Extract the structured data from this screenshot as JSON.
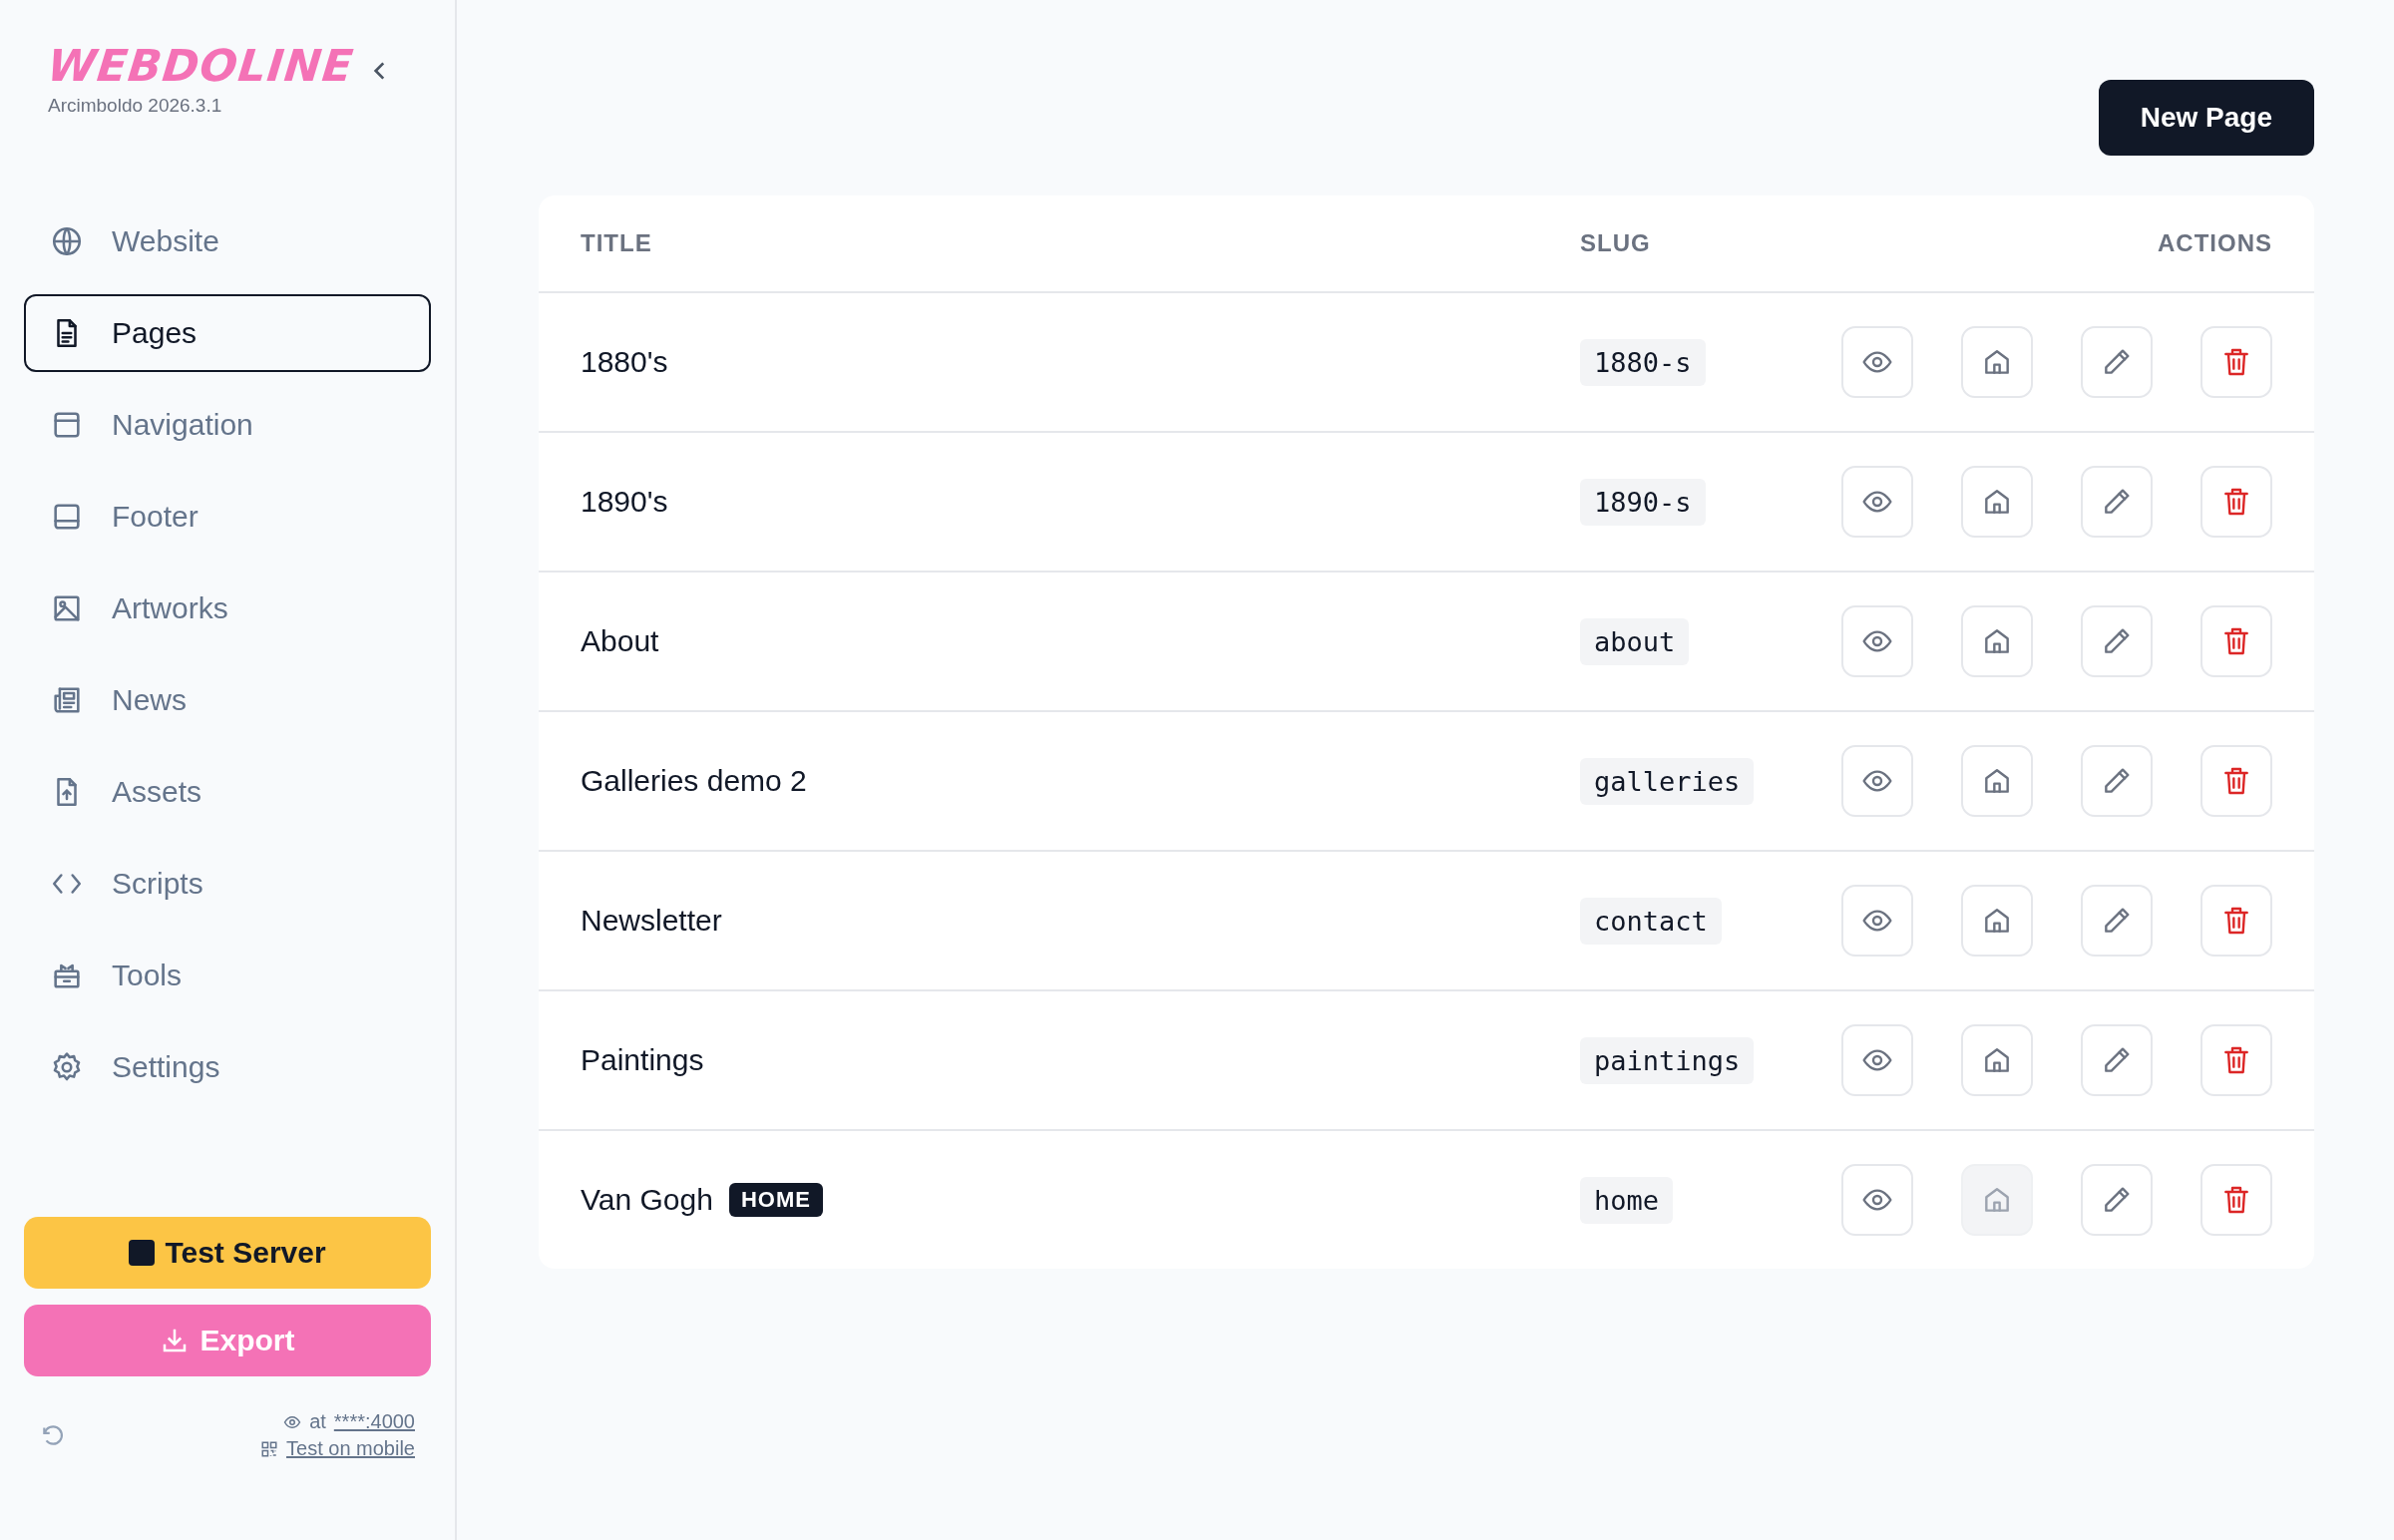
{
  "sidebar": {
    "logo": "WEBDOLINE",
    "version": "Arcimboldo 2026.3.1",
    "items": [
      {
        "label": "Website",
        "selected": false
      },
      {
        "label": "Pages",
        "selected": true
      },
      {
        "label": "Navigation",
        "selected": false
      },
      {
        "label": "Footer",
        "selected": false
      },
      {
        "label": "Artworks",
        "selected": false
      },
      {
        "label": "News",
        "selected": false
      },
      {
        "label": "Assets",
        "selected": false
      },
      {
        "label": "Scripts",
        "selected": false
      },
      {
        "label": "Tools",
        "selected": false
      },
      {
        "label": "Settings",
        "selected": false
      }
    ],
    "test_server": "Test Server",
    "export": "Export",
    "server_at": "at",
    "server_address": "****:4000",
    "mobile_link": "Test on mobile"
  },
  "new_page": "New Page",
  "table": {
    "columns": [
      "TITLE",
      "SLUG",
      "ACTIONS"
    ],
    "rows": [
      {
        "title": "1880's",
        "slug": "1880-s",
        "is_home": false
      },
      {
        "title": "1890's",
        "slug": "1890-s",
        "is_home": false
      },
      {
        "title": "About",
        "slug": "about",
        "is_home": false
      },
      {
        "title": "Galleries demo 2",
        "slug": "galleries",
        "is_home": false
      },
      {
        "title": "Newsletter",
        "slug": "contact",
        "is_home": false
      },
      {
        "title": "Paintings",
        "slug": "paintings",
        "is_home": false
      },
      {
        "title": "Van Gogh",
        "badge": "HOME",
        "slug": "home",
        "is_home": true
      }
    ]
  }
}
